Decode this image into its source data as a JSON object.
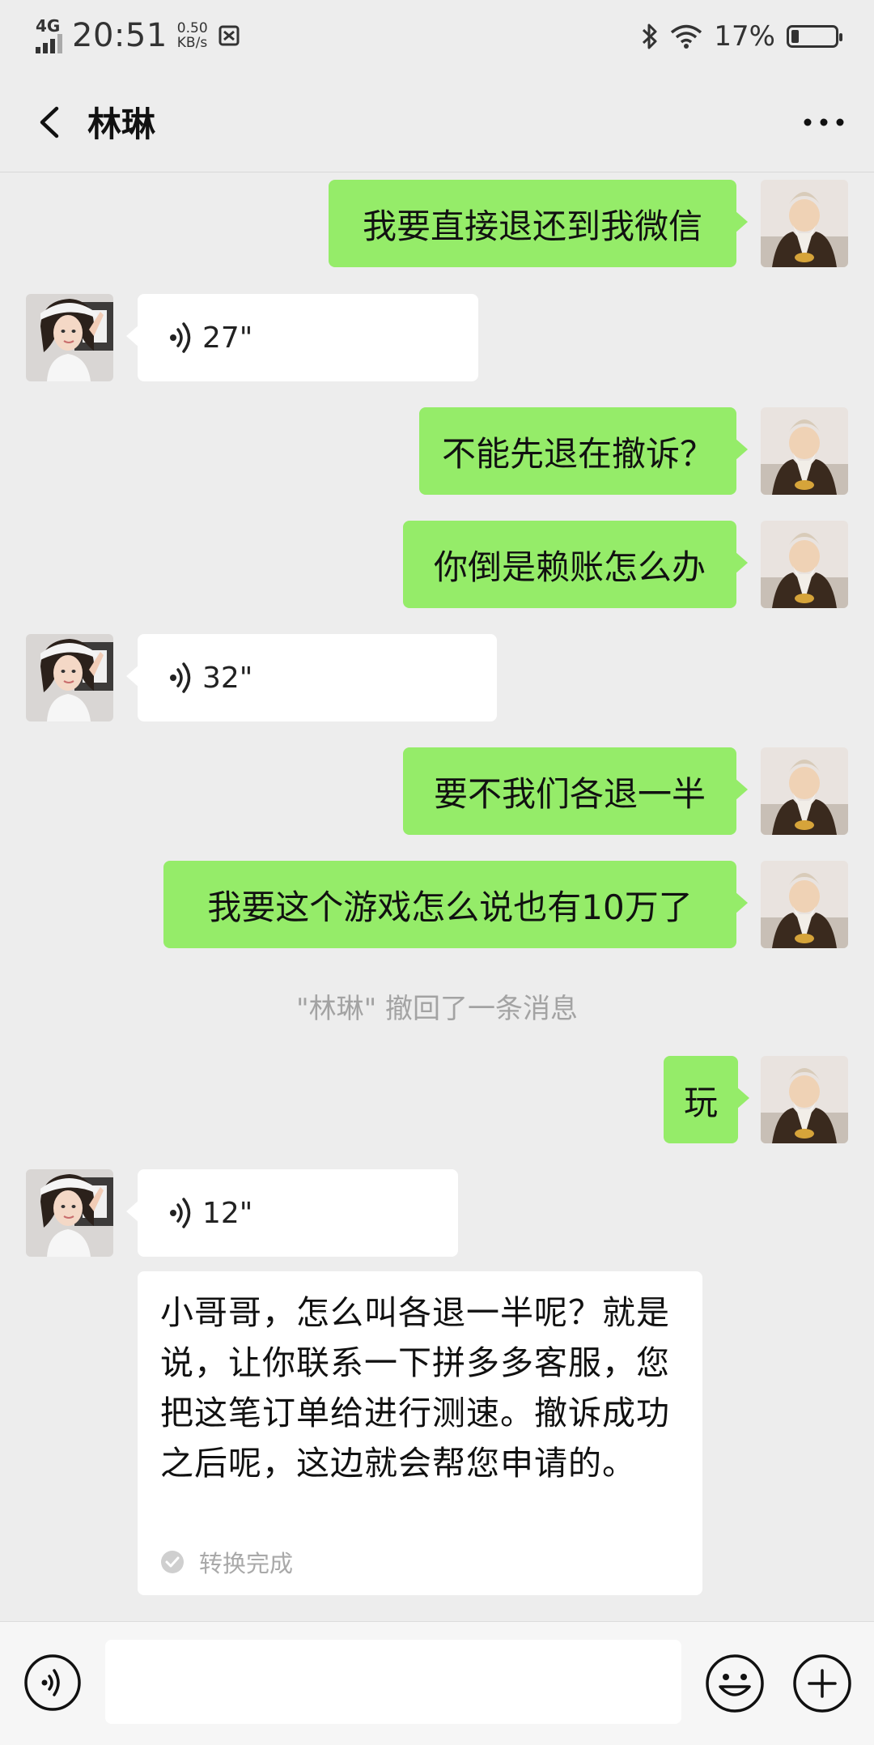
{
  "status_bar": {
    "network": "4G",
    "time": "20:51",
    "speed_value": "0.50",
    "speed_unit": "KB/s",
    "battery_percent": "17%",
    "battery_level": 0.17
  },
  "header": {
    "title": "林琳"
  },
  "messages": [
    {
      "side": "out",
      "type": "text",
      "text": "我要直接退还到我微信"
    },
    {
      "side": "in",
      "type": "voice",
      "duration": "27\""
    },
    {
      "side": "out",
      "type": "text",
      "text": "不能先退在撤诉？"
    },
    {
      "side": "out",
      "type": "text",
      "text": "你倒是赖账怎么办"
    },
    {
      "side": "in",
      "type": "voice",
      "duration": "32\""
    },
    {
      "side": "out",
      "type": "text",
      "text": "要不我们各退一半"
    },
    {
      "side": "out",
      "type": "text",
      "text": "我要这个游戏怎么说也有10万了"
    },
    {
      "side": "out",
      "type": "text",
      "text": "玩"
    },
    {
      "side": "in",
      "type": "voice",
      "duration": "12\""
    }
  ],
  "system_note": "\"林琳\" 撤回了一条消息",
  "transcript": {
    "text": "小哥哥，怎么叫各退一半呢？就是说，让你联系一下拼多多客服，您把这笔订单给进行测速。撤诉成功之后呢，这边就会帮您申请的。",
    "status": "转换完成"
  },
  "input": {
    "value": "",
    "placeholder": ""
  },
  "colors": {
    "background": "#ededed",
    "outgoing_bubble": "#95ec69",
    "incoming_bubble": "#ffffff",
    "system_text": "#a3a3a3"
  }
}
